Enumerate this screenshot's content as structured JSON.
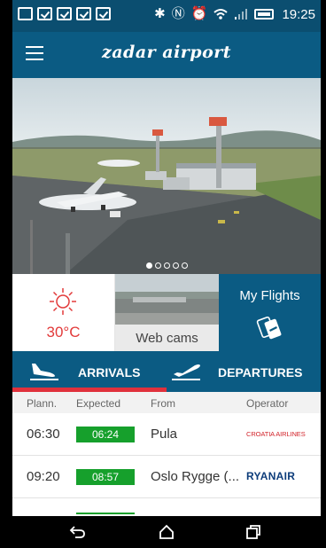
{
  "status_bar": {
    "time": "19:25",
    "icons": [
      "image-icon",
      "clipboard-check-icon",
      "clipboard-check-icon",
      "clipboard-check-icon",
      "clipboard-check-icon",
      "bluetooth-icon",
      "nfc-icon",
      "alarm-icon",
      "wifi-icon",
      "signal-icon",
      "battery-icon"
    ]
  },
  "app_bar": {
    "title": "zadar airport",
    "menu_icon": "hamburger-menu-icon"
  },
  "carousel": {
    "page_count": 5,
    "active_index": 0
  },
  "tiles": {
    "weather": {
      "icon": "sun-icon",
      "temperature": "30°C"
    },
    "webcam": {
      "label": "Web cams"
    },
    "my_flights": {
      "label": "My Flights",
      "icon": "boarding-pass-icon"
    }
  },
  "tabs": [
    {
      "label": "ARRIVALS",
      "icon": "plane-landing-icon",
      "active": true
    },
    {
      "label": "DEPARTURES",
      "icon": "plane-takeoff-icon",
      "active": false
    }
  ],
  "table": {
    "headers": {
      "planned": "Plann.",
      "expected": "Expected",
      "from": "From",
      "operator": "Operator"
    },
    "rows": [
      {
        "planned": "06:30",
        "expected": "06:24",
        "from": "Pula",
        "operator": "CROATIA AIRLINES"
      },
      {
        "planned": "09:20",
        "expected": "08:57",
        "from": "Oslo Rygge (...",
        "operator": "RYANAIR"
      }
    ]
  },
  "colors": {
    "primary": "#0b5b83",
    "accent": "#e0313c",
    "on_time": "#16a02c",
    "temperature": "#e23a3a"
  },
  "nav_bar": {
    "icons": [
      "back-icon",
      "home-icon",
      "recents-icon"
    ]
  }
}
